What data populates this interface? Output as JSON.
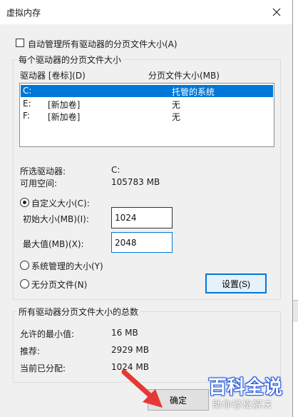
{
  "window": {
    "title": "虚拟内存"
  },
  "auto_manage": {
    "label": "自动管理所有驱动器的分页文件大小(A)",
    "checked": false
  },
  "per_drive": {
    "group_label": "每个驱动器的分页文件大小",
    "col_drive": "驱动器 [卷标](D)",
    "col_size": "分页文件大小(MB)",
    "rows": [
      {
        "drive": "C:",
        "label": "",
        "size": "托管的系统",
        "selected": true
      },
      {
        "drive": "E:",
        "label": "[新加卷]",
        "size": "无",
        "selected": false
      },
      {
        "drive": "F:",
        "label": "[新加卷]",
        "size": "无",
        "selected": false
      }
    ],
    "selected_drive_label": "所选驱动器:",
    "selected_drive_value": "C:",
    "free_space_label": "可用空间:",
    "free_space_value": "105783 MB",
    "custom_size": {
      "label": "自定义大小(C):",
      "selected": true
    },
    "initial_size": {
      "label": "初始大小(MB)(I):",
      "value": "1024"
    },
    "max_size": {
      "label": "最大值(MB)(X):",
      "value": "2048"
    },
    "system_managed": {
      "label": "系统管理的大小(Y)",
      "selected": false
    },
    "no_paging": {
      "label": "无分页文件(N)",
      "selected": false
    },
    "set_button": "设置(S)"
  },
  "totals": {
    "group_label": "所有驱动器分页文件大小的总数",
    "min_label": "允许的最小值:",
    "min_value": "16 MB",
    "recommended_label": "推荐:",
    "recommended_value": "2929 MB",
    "current_label": "当前已分配:",
    "current_value": "1024 MB"
  },
  "buttons": {
    "ok": "确定"
  },
  "watermark": {
    "brand": "百科全说",
    "slogan": "助你轻松解决"
  },
  "colors": {
    "selection": "#0078d7",
    "arrow": "#e53935",
    "brand": "#2a5bd7"
  }
}
